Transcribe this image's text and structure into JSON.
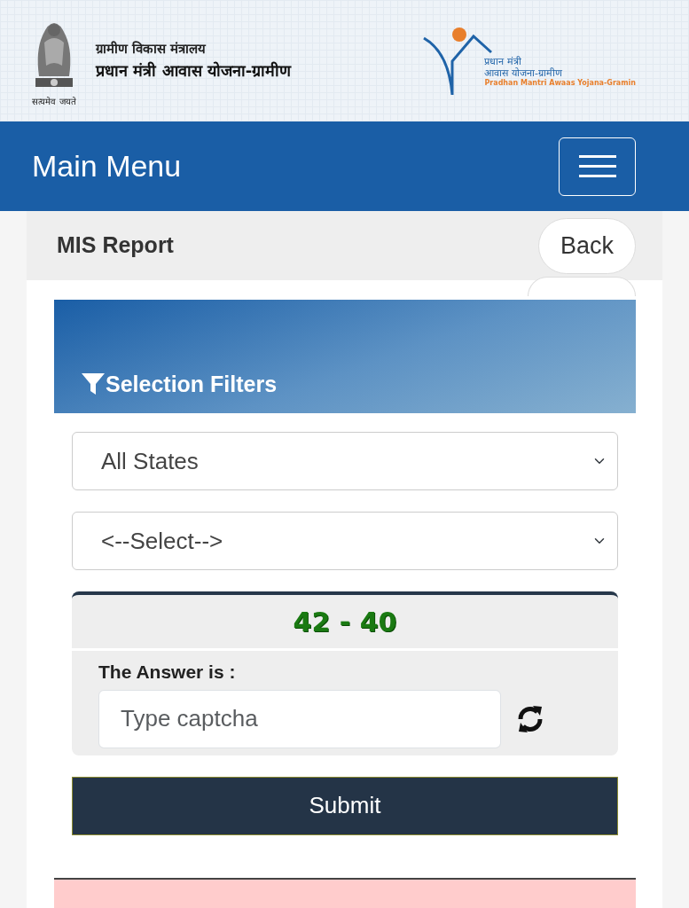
{
  "header": {
    "ministry": "ग्रामीण विकास मंत्रालय",
    "scheme": "प्रधान मंत्री आवास योजना-ग्रामीण",
    "emblem_motto": "सत्यमेव जयते",
    "logo_lines": [
      "प्रधान मंत्री",
      "आवास योजना-ग्रामीण",
      "Pradhan Mantri Awaas Yojana-Gramin"
    ]
  },
  "navbar": {
    "title": "Main Menu"
  },
  "page": {
    "title": "MIS Report",
    "back_button": "Back"
  },
  "filters": {
    "title": "Selection Filters",
    "selects": [
      {
        "value": "All States"
      },
      {
        "value": "<--Select-->"
      }
    ],
    "captcha": {
      "question": "42 - 40",
      "label": "The Answer is :",
      "placeholder": "Type captcha"
    },
    "submit": "Submit"
  }
}
